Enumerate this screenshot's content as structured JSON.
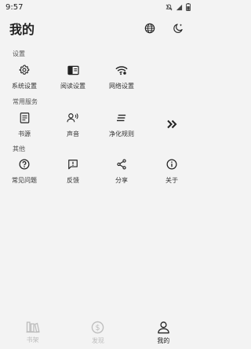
{
  "status_bar": {
    "time": "9:57"
  },
  "header": {
    "title": "我的"
  },
  "sections": {
    "settings": {
      "title": "设置",
      "items": [
        {
          "label": "系统设置",
          "icon": "gear-icon"
        },
        {
          "label": "阅读设置",
          "icon": "book-open-icon"
        },
        {
          "label": "网络设置",
          "icon": "wifi-settings-icon"
        }
      ]
    },
    "services": {
      "title": "常用服务",
      "items": [
        {
          "label": "书源",
          "icon": "document-list-icon"
        },
        {
          "label": "声音",
          "icon": "voice-icon"
        },
        {
          "label": "净化规则",
          "icon": "filter-lines-icon"
        }
      ],
      "more_icon": "double-chevron-right-icon"
    },
    "other": {
      "title": "其他",
      "items": [
        {
          "label": "常见问题",
          "icon": "help-circle-icon"
        },
        {
          "label": "反馈",
          "icon": "feedback-icon"
        },
        {
          "label": "分享",
          "icon": "share-icon"
        },
        {
          "label": "关于",
          "icon": "info-icon"
        }
      ]
    }
  },
  "bottom_nav": {
    "items": [
      {
        "label": "书架",
        "icon": "bookshelf-icon",
        "active": false
      },
      {
        "label": "发现",
        "icon": "discover-coin-icon",
        "active": false
      },
      {
        "label": "我的",
        "icon": "person-icon",
        "active": true
      }
    ]
  },
  "colors": {
    "background": "#f3f3f3",
    "text": "#222222",
    "inactive": "#bdbdbd"
  }
}
